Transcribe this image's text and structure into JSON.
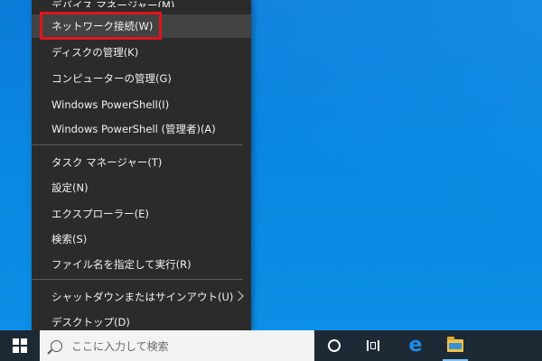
{
  "menu": {
    "items": [
      {
        "label": "デバイス マネージャー(M)"
      },
      {
        "label": "ネットワーク接続(W)"
      },
      {
        "label": "ディスクの管理(K)"
      },
      {
        "label": "コンピューターの管理(G)"
      },
      {
        "label": "Windows PowerShell(I)"
      },
      {
        "label": "Windows PowerShell (管理者)(A)"
      },
      {
        "label": "タスク マネージャー(T)"
      },
      {
        "label": "設定(N)"
      },
      {
        "label": "エクスプローラー(E)"
      },
      {
        "label": "検索(S)"
      },
      {
        "label": "ファイル名を指定して実行(R)"
      },
      {
        "label": "シャットダウンまたはサインアウト(U)"
      },
      {
        "label": "デスクトップ(D)"
      }
    ],
    "highlight_color": "#e1151a"
  },
  "taskbar": {
    "search_placeholder": "ここに入力して検索",
    "icons": [
      "windows-start-icon",
      "search-icon",
      "cortana-icon",
      "task-view-icon",
      "edge-icon",
      "file-explorer-icon"
    ]
  },
  "colors": {
    "menu_bg": "#2b2b2b",
    "desktop": "#0a86e0",
    "taskbar": "#1d2a36"
  }
}
